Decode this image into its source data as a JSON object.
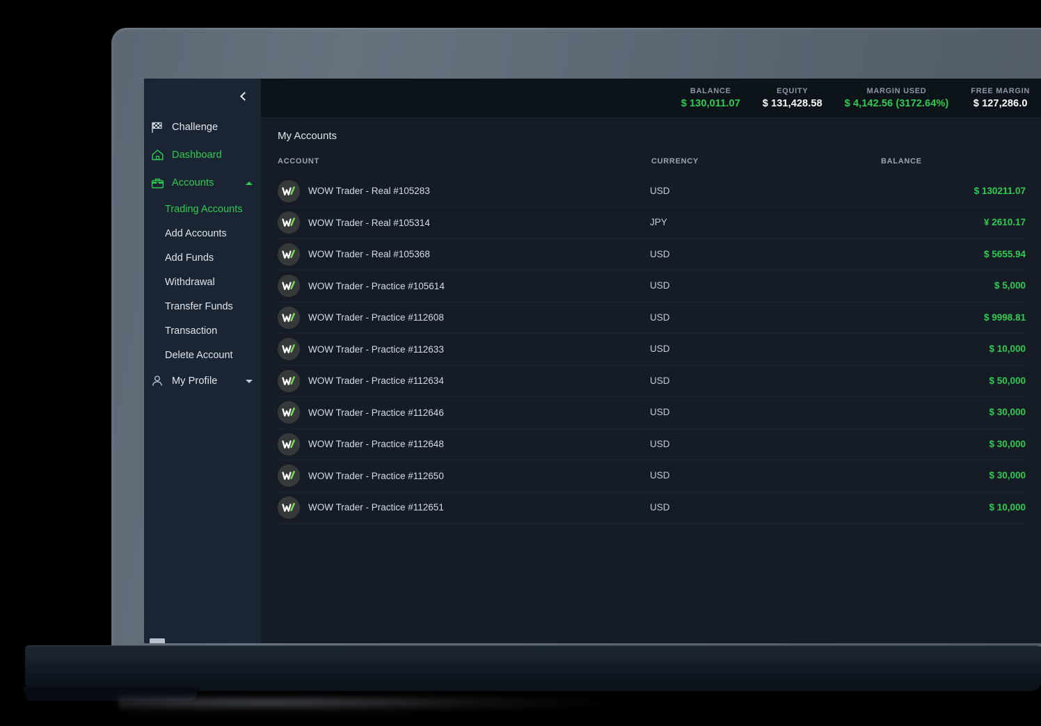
{
  "topbar": {
    "stats": [
      {
        "label": "BALANCE",
        "value": "$ 130,011.07",
        "color": "green"
      },
      {
        "label": "EQUITY",
        "value": "$ 131,428.58",
        "color": "white"
      },
      {
        "label": "MARGIN USED",
        "value": "$ 4,142.56 (3172.64%)",
        "color": "green"
      },
      {
        "label": "FREE MARGIN",
        "value": "$ 127,286.0",
        "color": "white"
      }
    ]
  },
  "sidebar": {
    "collapse_icon": "chevron-left-icon",
    "items": [
      {
        "label": "Challenge",
        "icon": "flag-icon",
        "active": false,
        "caret": ""
      },
      {
        "label": "Dashboard",
        "icon": "home-icon",
        "active": true,
        "caret": ""
      },
      {
        "label": "Accounts",
        "icon": "briefcase-icon",
        "active": true,
        "caret": "up"
      }
    ],
    "sub_items": [
      {
        "label": "Trading Accounts",
        "active": true
      },
      {
        "label": "Add Accounts",
        "active": false
      },
      {
        "label": "Add Funds",
        "active": false
      },
      {
        "label": "Withdrawal",
        "active": false
      },
      {
        "label": "Transfer Funds",
        "active": false
      },
      {
        "label": "Transaction",
        "active": false
      },
      {
        "label": "Delete Account",
        "active": false
      }
    ],
    "profile": {
      "label": "My Profile",
      "icon": "person-icon",
      "caret": "down"
    }
  },
  "main": {
    "title": "My Accounts",
    "columns": {
      "account": "ACCOUNT",
      "currency": "CURRENCY",
      "balance": "BALANCE"
    },
    "rows": [
      {
        "name": "WOW Trader - Real #105283",
        "currency": "USD",
        "balance": "$ 130211.07"
      },
      {
        "name": "WOW Trader - Real #105314",
        "currency": "JPY",
        "balance": "¥ 2610.17"
      },
      {
        "name": "WOW Trader - Real #105368",
        "currency": "USD",
        "balance": "$ 5655.94"
      },
      {
        "name": "WOW Trader - Practice #105614",
        "currency": "USD",
        "balance": "$ 5,000"
      },
      {
        "name": "WOW Trader - Practice #112608",
        "currency": "USD",
        "balance": "$ 9998.81"
      },
      {
        "name": "WOW Trader - Practice #112633",
        "currency": "USD",
        "balance": "$ 10,000"
      },
      {
        "name": "WOW Trader - Practice #112634",
        "currency": "USD",
        "balance": "$ 50,000"
      },
      {
        "name": "WOW Trader - Practice #112646",
        "currency": "USD",
        "balance": "$ 30,000"
      },
      {
        "name": "WOW Trader - Practice #112648",
        "currency": "USD",
        "balance": "$ 30,000"
      },
      {
        "name": "WOW Trader - Practice #112650",
        "currency": "USD",
        "balance": "$ 30,000"
      },
      {
        "name": "WOW Trader - Practice #112651",
        "currency": "USD",
        "balance": "$ 10,000"
      }
    ],
    "row_avatar_icon": "wow-logo-icon"
  },
  "colors": {
    "accent_green": "#2ecc52",
    "screen_bg": "#151c26",
    "sidebar_bg": "#1b2432",
    "topbar_bg": "#0d1419",
    "page_bg": "#000000"
  }
}
